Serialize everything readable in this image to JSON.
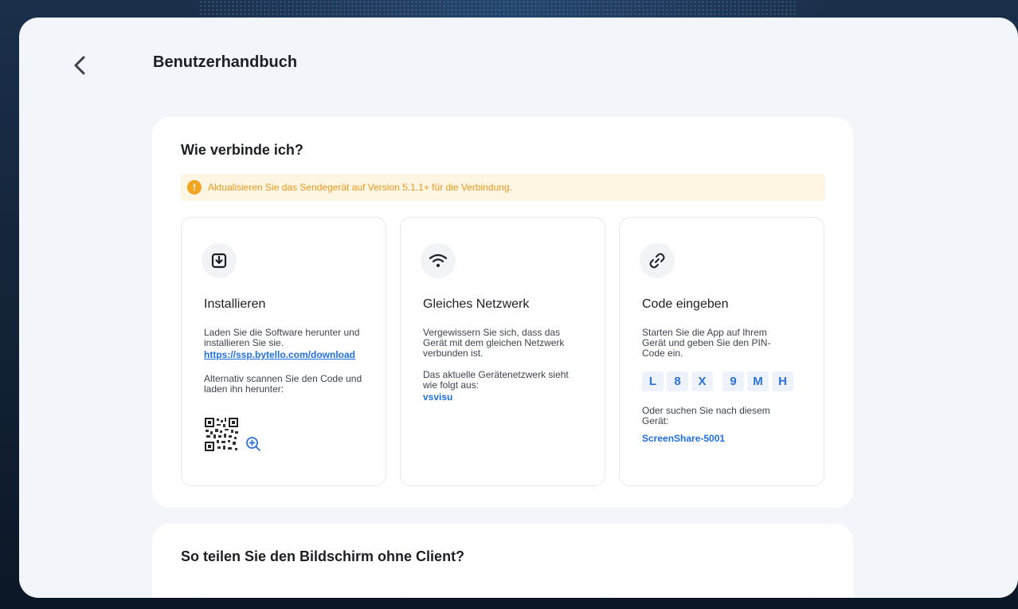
{
  "header": {
    "title": "Benutzerhandbuch"
  },
  "connect_card": {
    "title": "Wie verbinde ich?",
    "notice": "Aktualisieren Sie das Sendegerät auf Version 5.1.1+ für die Verbindung.",
    "notice_icon": "!",
    "steps": [
      {
        "icon": "download-icon",
        "heading": "Installieren",
        "text1": "Laden Sie die Software herunter und installieren Sie sie.",
        "link": "https://ssp.bytello.com/download",
        "text2": "Alternativ scannen Sie den Code und laden ihn herunter:"
      },
      {
        "icon": "wifi-icon",
        "heading": "Gleiches Netzwerk",
        "text1": "Vergewissern Sie sich, dass das Gerät mit dem gleichen Netzwerk verbunden ist.",
        "text2": "Das aktuelle Gerätenetzwerk sieht wie folgt aus:",
        "network": "vsvisu"
      },
      {
        "icon": "link-icon",
        "heading": "Code eingeben",
        "text1": "Starten Sie die App auf Ihrem Gerät und geben Sie den PIN-Code ein.",
        "pin": [
          "L",
          "8",
          "X",
          "9",
          "M",
          "H"
        ],
        "text2": "Oder suchen Sie nach diesem Gerät:",
        "device": "ScreenShare-5001"
      }
    ]
  },
  "second_card": {
    "title": "So teilen Sie den Bildschirm ohne Client?"
  },
  "colors": {
    "accent": "#1f6fe0",
    "warning": "#f2a320",
    "panel": "#f2f5f9"
  }
}
